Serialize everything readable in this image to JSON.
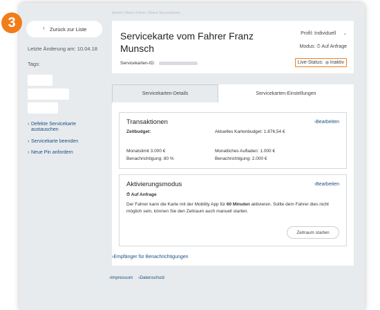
{
  "step_badge": "3",
  "sidebar": {
    "back_label": "Zurück zur Liste",
    "last_change": "Letzte Änderung am: 10.04.18",
    "tags_label": "Tags:",
    "links": [
      "Defekte Servicekarte austauschen",
      "Servicekarte beenden",
      "Neue Pin anfordern"
    ]
  },
  "breadcrumb": "Einheit | Meine Fahrer | Meine Servicekarten",
  "header": {
    "title": "Servicekarte vom Fahrer Franz Munsch",
    "id_label": "Servicekarten-ID:",
    "profile": "Profil: Individuell",
    "mode": "Modus: ⏱ Auf Anfrage",
    "live_status_label": "Live-Status:",
    "live_status_value": "Inaktiv"
  },
  "tabs": [
    "Servicekarten-Details",
    "Servicekarten-Einstellungen"
  ],
  "transaktionen": {
    "title": "Transaktionen",
    "edit": "Bearbeiten",
    "zeitbudget_label": "Zeitbudget:",
    "aktuelles_budget": "Aktuelles Kartenbudget: 1.876,54 €",
    "monatslimit": "Monatslimit 3.000 €",
    "benachrichtigung_pct": "Benachrichtigung: 80 %",
    "aufladen": "Monatliches Aufladen: 1.000 €",
    "benachrichtigung_abs": "Benachrichtigung: 2.000 €"
  },
  "aktivierung": {
    "title": "Aktivierungsmodus",
    "edit": "Bearbeiten",
    "mode": "⏱ Auf Anfrage",
    "text_before": "Der Fahrer kann die Karte mit der Mobility App für ",
    "text_bold": "60 Minuten",
    "text_after": " aktivieren. Sollte dem Fahrer dies nicht möglich sein, können Sie den Zeitraum auch manuell starten.",
    "button": "Zeitraum starten"
  },
  "recipients_link": "Empfänger für Benachrichtigungen",
  "footer": [
    "Impressum",
    "Datenschutz"
  ]
}
